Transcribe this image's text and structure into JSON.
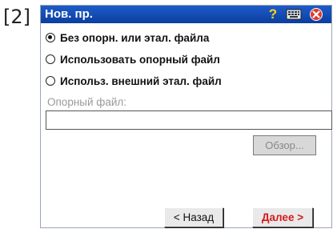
{
  "figure_label": "[2]",
  "window": {
    "title": "Нов. пр.",
    "icons": [
      "help-icon",
      "keyboard-icon",
      "close-icon"
    ]
  },
  "options": [
    {
      "label": "Без опорн. или этал. файла",
      "selected": true
    },
    {
      "label": "Использовать опорный файл",
      "selected": false
    },
    {
      "label": "Использ. внешний этал. файл",
      "selected": false
    }
  ],
  "reference_file": {
    "label": "Опорный файл:",
    "value": "",
    "browse_label": "Обзор..."
  },
  "buttons": {
    "back_label": "< Назад",
    "next_label": "Далее >"
  },
  "colors": {
    "title_bar": "#1e5cc8",
    "next_text": "#d61b1b"
  }
}
